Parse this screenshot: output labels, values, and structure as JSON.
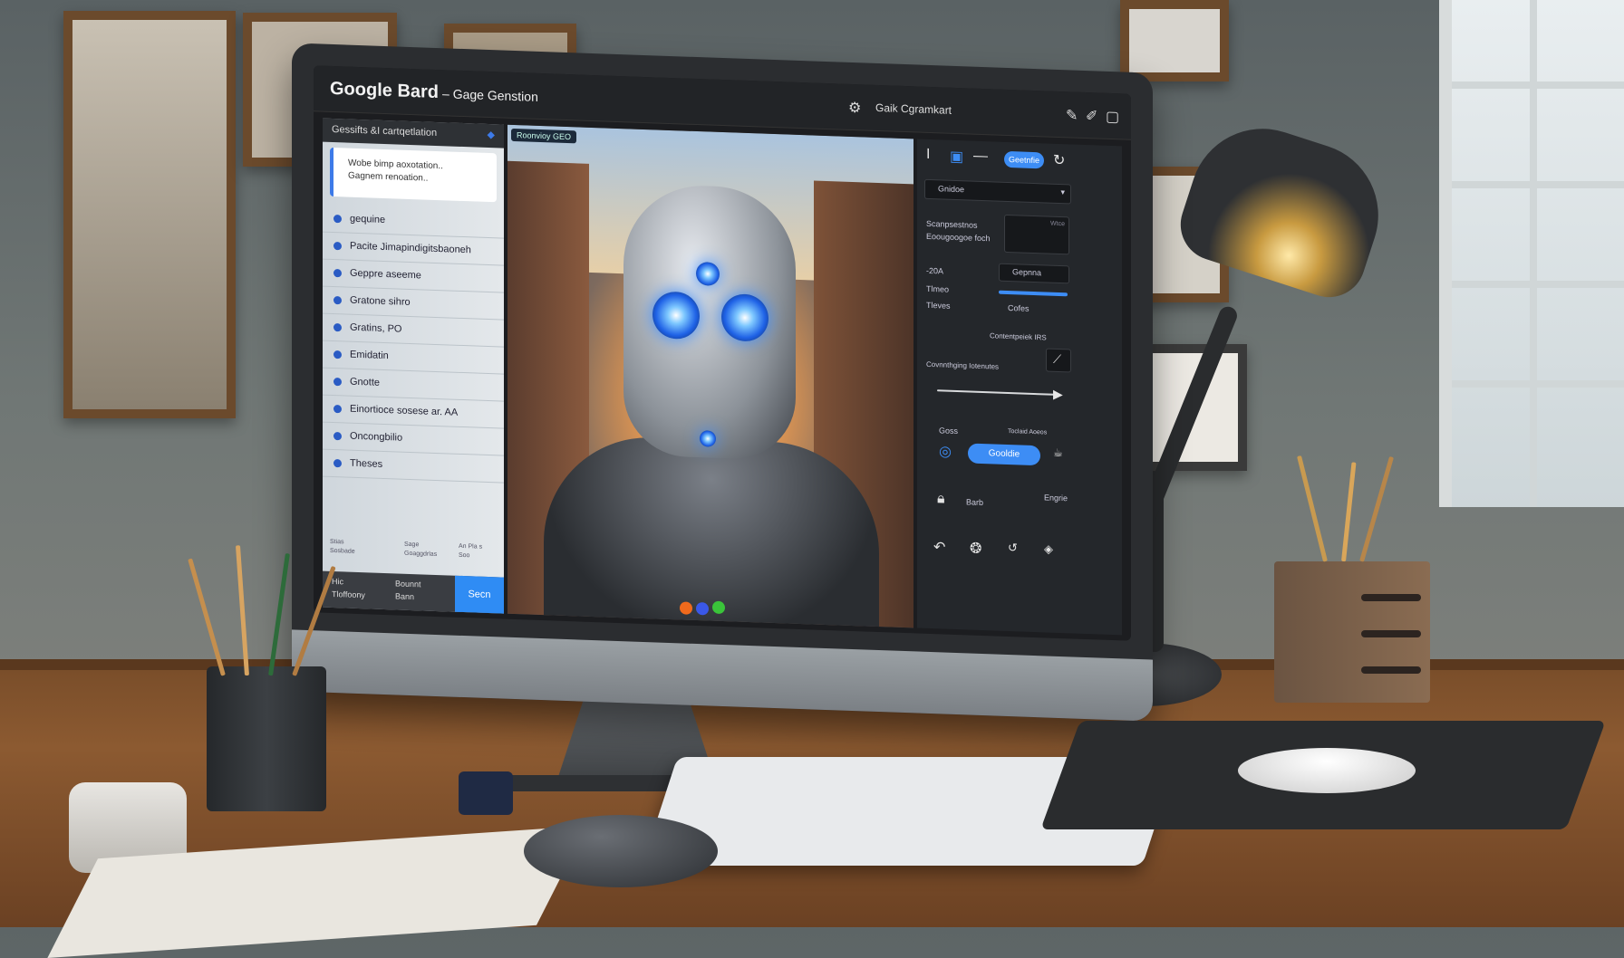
{
  "app": {
    "title": "Google Bard",
    "subtitle": "– Gage Genstion",
    "toolbar_title": "Gaik Cgramkart"
  },
  "sidebar": {
    "header": "Gessifts &I cartqetlation",
    "card_line1": "Wobe bimp aoxotation..",
    "card_line2": "Gagnem renoation..",
    "items": [
      {
        "label": "gequine"
      },
      {
        "label": "Pacite Jimapindigitsbaoneh"
      },
      {
        "label": "Geppre aseeme"
      },
      {
        "label": "Gratone sihro"
      },
      {
        "label": "Gratins, PO"
      },
      {
        "label": "Emidatin"
      },
      {
        "label": "Gnotte"
      },
      {
        "label": "Einortioce sosese ar. AA"
      },
      {
        "label": "Oncongbilio"
      },
      {
        "label": "Theses"
      }
    ],
    "footer": {
      "left_top": "Hic",
      "left_bottom": "Tloffoony",
      "middle_top": "Bounnt",
      "middle_bottom": "Bann",
      "send_label": "Secn"
    },
    "mini_labels": [
      "Stias",
      "Sosbade",
      "Sage",
      "Goaggdrlas",
      "An Pla s",
      "Soo"
    ]
  },
  "canvas": {
    "tag": "Roonvioy  GEO"
  },
  "panel": {
    "button_primary": "Geetnfie",
    "dropdown": "Gnidoe",
    "label_1": "Scanpsestnos",
    "label_2": "Eoougoogoe foch",
    "label_3": "Wtce",
    "row_a_left": "-20A",
    "row_a_right": "Gepnna",
    "row_b_left": "Tlmeo",
    "row_c_left": "Tleves",
    "row_c_right": "Cofes",
    "label_4": "Contentpeiek IRS",
    "label_5": "Covnnthging  Iotenutes",
    "label_6": "Goss",
    "label_7": "Toclaid Aoeos",
    "button_secondary": "Gooldie",
    "label_8": "Barb",
    "label_9": "Engrie"
  },
  "colors": {
    "accent": "#3d8df5",
    "screen_bg": "#1c1d20",
    "panel_bg": "#24272b"
  }
}
